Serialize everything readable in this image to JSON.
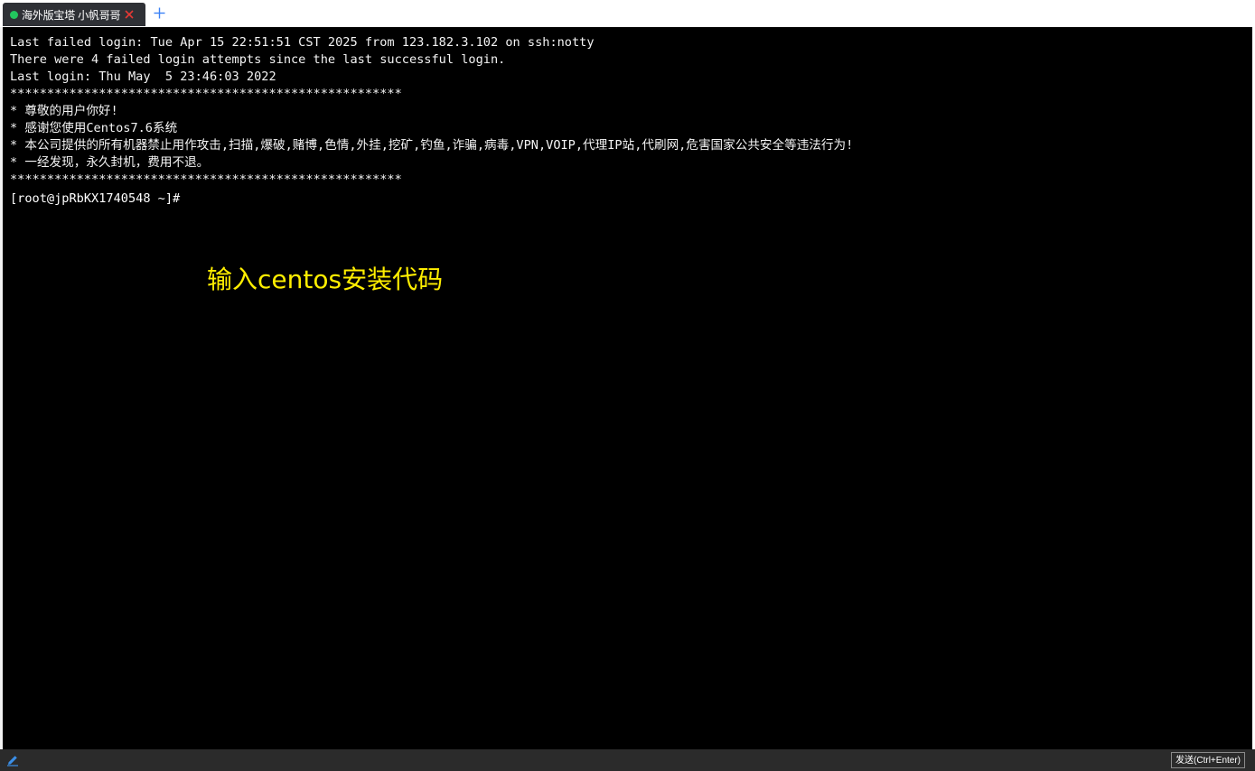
{
  "tabs": [
    {
      "label": "海外版宝塔 小帆哥哥",
      "status_color": "#22c55e",
      "active": true
    }
  ],
  "colors": {
    "terminal_bg": "#000000",
    "terminal_text": "#f4f4f4",
    "annotation": "#ffee00",
    "tab_bg": "#2f3136",
    "close_icon": "#e53935",
    "new_tab_icon": "#3b82f6",
    "bottom_bar": "#2b2b2b"
  },
  "terminal": {
    "lines": [
      "Last failed login: Tue Apr 15 22:51:51 CST 2025 from 123.182.3.102 on ssh:notty",
      "There were 4 failed login attempts since the last successful login.",
      "Last login: Thu May  5 23:46:03 2022",
      "*****************************************************",
      "* 尊敬的用户你好!",
      "* 感谢您使用Centos7.6系统",
      "* 本公司提供的所有机器禁止用作攻击,扫描,爆破,赌博,色情,外挂,挖矿,钓鱼,诈骗,病毒,VPN,VOIP,代理IP站,代刷网,危害国家公共安全等违法行为!",
      "* 一经发现，永久封机，费用不退。",
      "*****************************************************"
    ],
    "prompt": "[root@jpRbKX1740548 ~]#"
  },
  "annotation": {
    "text": "输入centos安装代码"
  },
  "bottom_bar": {
    "edit_icon": "pencil-icon",
    "send_label": "发送(Ctrl+Enter)"
  }
}
